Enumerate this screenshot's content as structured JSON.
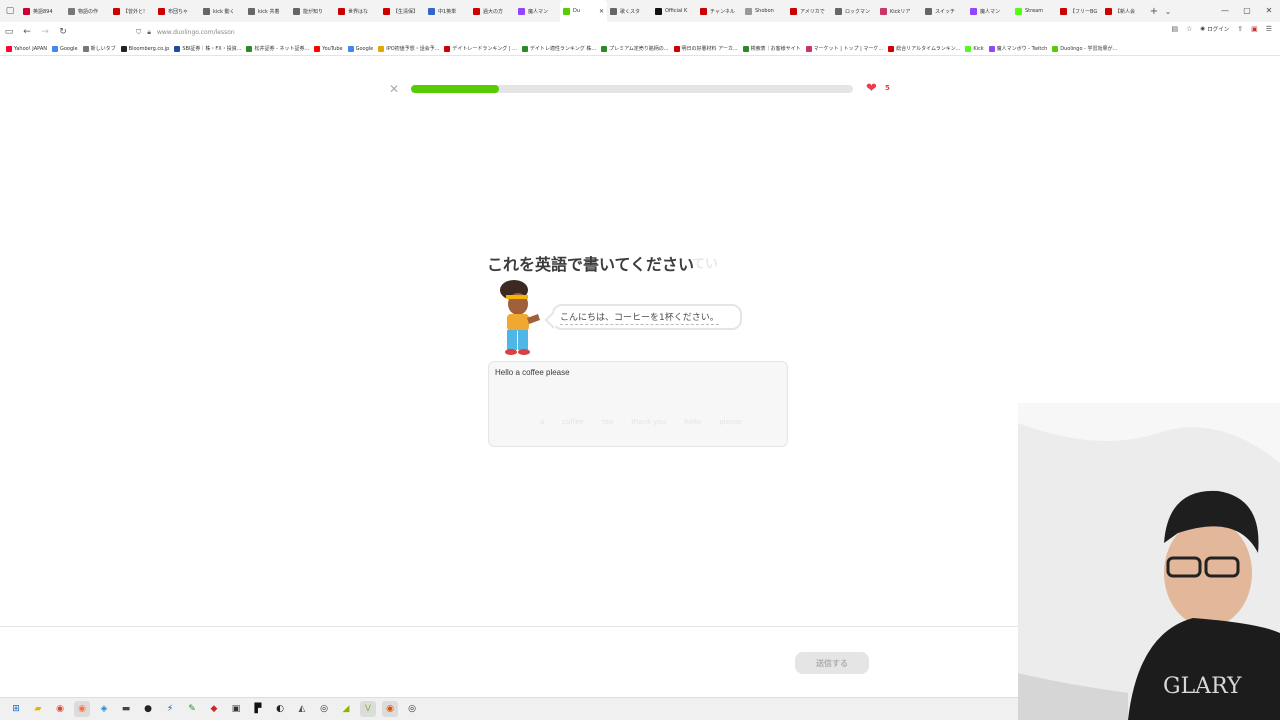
{
  "browser": {
    "tabs": [
      {
        "title": "英語894",
        "color": "#cc0033"
      },
      {
        "title": "物語の作",
        "color": "#777777"
      },
      {
        "title": "【曾外と!",
        "color": "#cc0000"
      },
      {
        "title": "布団ちゃ",
        "color": "#cc0000"
      },
      {
        "title": "kick 動く",
        "color": "#666666"
      },
      {
        "title": "kick 共着",
        "color": "#666666"
      },
      {
        "title": "能が知り",
        "color": "#666666"
      },
      {
        "title": "世界はな",
        "color": "#cc0000"
      },
      {
        "title": "【生清保】",
        "color": "#cc0000"
      },
      {
        "title": "中1英単",
        "color": "#3366cc"
      },
      {
        "title": "過大の方",
        "color": "#cc0000"
      },
      {
        "title": "魔人マン",
        "color": "#9146ff"
      },
      {
        "title": "Du",
        "color": "#58cc02",
        "active": true
      },
      {
        "title": "歌くスタ",
        "color": "#666666"
      },
      {
        "title": "Official K",
        "color": "#111111"
      },
      {
        "title": "チャンネル",
        "color": "#cc0000"
      },
      {
        "title": "Shobon",
        "color": "#999999"
      },
      {
        "title": "アメリカで",
        "color": "#cc0000"
      },
      {
        "title": "ロックマン",
        "color": "#666666"
      },
      {
        "title": "Kickリア",
        "color": "#cc3366"
      },
      {
        "title": "スイッチ",
        "color": "#666666"
      },
      {
        "title": "魔人マン",
        "color": "#9146ff"
      },
      {
        "title": "Stream",
        "color": "#53fc18"
      },
      {
        "title": "【フリーBG",
        "color": "#cc0000"
      },
      {
        "title": "【新人会",
        "color": "#cc0000"
      }
    ],
    "url": "www.duolingo.com/lesson",
    "login_label": "ログイン",
    "bookmarks": [
      {
        "label": "Yahoo! JAPAN",
        "color": "#ff0033"
      },
      {
        "label": "Google",
        "color": "#4285f4"
      },
      {
        "label": "新しいタブ",
        "color": "#777777"
      },
      {
        "label": "Bloomberg.co.jp",
        "color": "#222222"
      },
      {
        "label": "SBI証券｜株・FX・投資...",
        "color": "#1a4fa0"
      },
      {
        "label": "松井証券 - ネット証券...",
        "color": "#2a8a2a"
      },
      {
        "label": "YouTube",
        "color": "#ff0000"
      },
      {
        "label": "Google",
        "color": "#4285f4"
      },
      {
        "label": "IPO初値予想・話会予...",
        "color": "#e0a800"
      },
      {
        "label": "デイトレードランキング | ...",
        "color": "#cc0000"
      },
      {
        "label": "デイトレ適性ランキング 株...",
        "color": "#2a8a2a"
      },
      {
        "label": "プレミアム定売り銘柄の...",
        "color": "#2a8a2a"
      },
      {
        "label": "明日の好悪材料 アーカ...",
        "color": "#cc0000"
      },
      {
        "label": "検索表｜お客様サイト",
        "color": "#2a8a2a"
      },
      {
        "label": "マーケット | トップ | マーケ...",
        "color": "#cc3366"
      },
      {
        "label": "総合リアルタイムランキン...",
        "color": "#cc0000"
      },
      {
        "label": "Kick",
        "color": "#53fc18"
      },
      {
        "label": "魔人マンボウ - Twitch",
        "color": "#9146ff"
      },
      {
        "label": "Duolingo - 学習効果が...",
        "color": "#58cc02"
      }
    ]
  },
  "lesson": {
    "progress_fraction": 0.2,
    "hearts": "5",
    "prompt": "これを英語で書いてください",
    "prompt_ghost": "てい",
    "speech": "こんにちは、コーヒーを1杯ください。",
    "answer_value": "Hello a coffee please",
    "word_bank": [
      "a",
      "coffee",
      "tea",
      "thank you",
      "hello",
      "please"
    ],
    "submit_label": "送信する"
  },
  "colors": {
    "accent_green": "#58cc02",
    "heart_red": "#ee3a4a"
  }
}
